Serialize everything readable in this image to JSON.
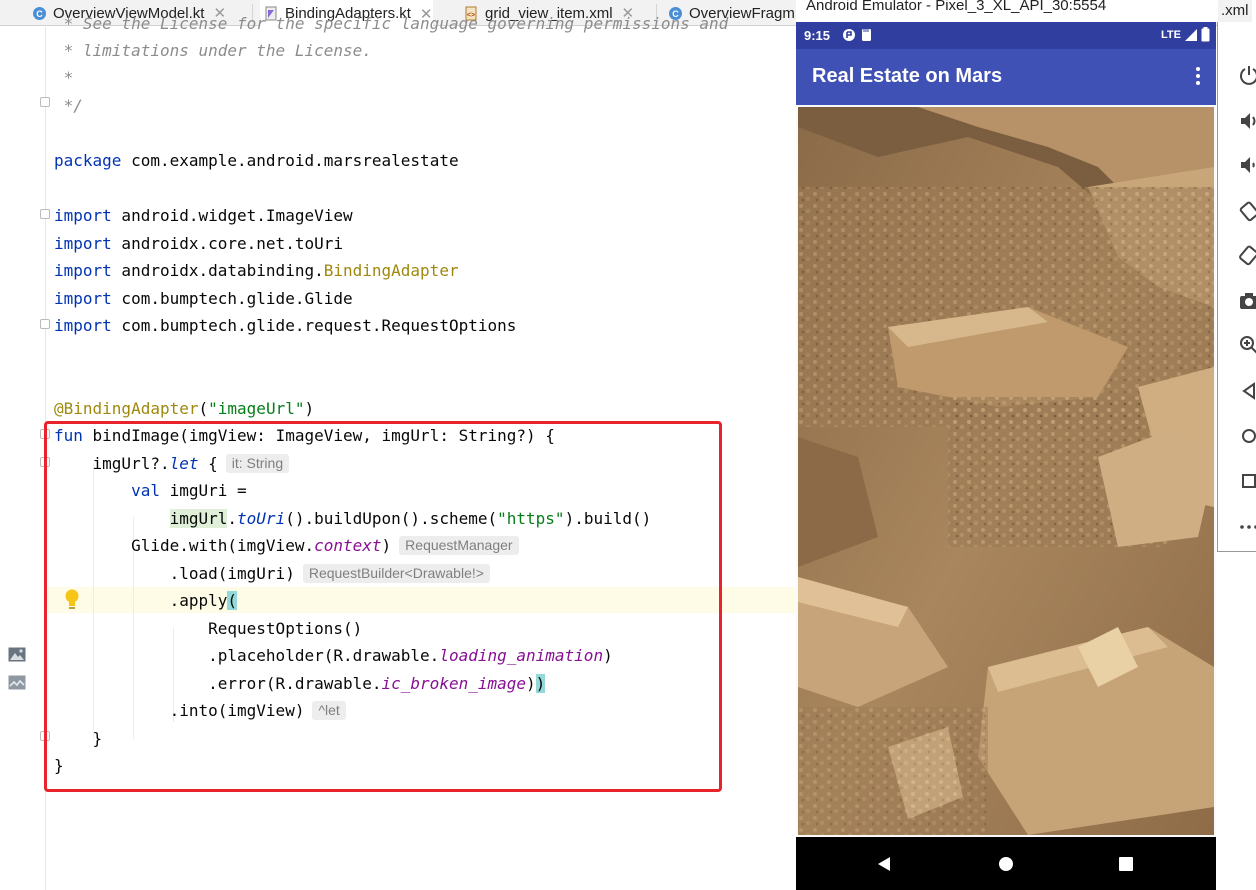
{
  "tabs": [
    {
      "label": "OverviewViewModel.kt",
      "icon": "kotlin-class-icon",
      "active": false
    },
    {
      "label": "BindingAdapters.kt",
      "icon": "kotlin-file-icon",
      "active": true
    },
    {
      "label": "grid_view_item.xml",
      "icon": "xml-file-icon",
      "active": false
    },
    {
      "label": "OverviewFragm",
      "icon": "kotlin-class-icon",
      "active": false
    }
  ],
  "overflow_tab": ".xml",
  "code": {
    "comment_lines": [
      " * See the License for the specific language governing permissions and",
      " * limitations under the License.",
      " *",
      " */"
    ],
    "package_kw": "package",
    "package_name": " com.example.android.marsrealestate",
    "imports": [
      {
        "kw": "import",
        "path": " android.widget.ImageView",
        "annotated": false
      },
      {
        "kw": "import",
        "path": " androidx.core.net.toUri",
        "annotated": false
      },
      {
        "kw": "import",
        "path": " androidx.databinding.",
        "annotated_part": "BindingAdapter",
        "annotated": true
      },
      {
        "kw": "import",
        "path": " com.bumptech.glide.Glide",
        "annotated": false
      },
      {
        "kw": "import",
        "path": " com.bumptech.glide.request.RequestOptions",
        "annotated": false
      }
    ],
    "annotation": "@BindingAdapter",
    "annotation_arg": "\"imageUrl\"",
    "fun_kw": "fun",
    "fun_sig": " bindImage(imgView: ImageView, imgUrl: String?) {",
    "let_prefix": "    imgUrl?.",
    "let_kw": "let",
    "let_suffix": " {",
    "hint_it": "it: String",
    "val_kw": "val",
    "val_decl": " imgUri =",
    "uri_var": "imgUrl",
    "uri_call_dot": ".",
    "uri_fn": "toUri",
    "uri_chain_a": "().buildUpon().scheme(",
    "uri_scheme": "\"https\"",
    "uri_chain_b": ").build()",
    "glide_a": "Glide.with(imgView.",
    "glide_prop": "context",
    "glide_b": ")",
    "hint_glide": "RequestManager",
    "load_call": ".load(imgUri)",
    "hint_load": "RequestBuilder<Drawable!>",
    "apply_call": ".apply",
    "apply_paren": "(",
    "req_options": "RequestOptions()",
    "placeholder_a": ".placeholder(R.drawable.",
    "placeholder_res": "loading_animation",
    "placeholder_b": ")",
    "error_a": ".error(R.drawable.",
    "error_res": "ic_broken_image",
    "error_b": ")",
    "error_c": ")",
    "into_call": ".into(imgView)",
    "hint_into": "^let",
    "close_inner": "    }",
    "close_outer": "}"
  },
  "emulator": {
    "window_title": "Android Emulator - Pixel_3_XL_API_30:5554",
    "time": "9:15",
    "network": "LTE",
    "app_title": "Real Estate on Mars",
    "image_icon": "mars-surface-photo"
  },
  "colors": {
    "app_bar": "#3f51b5",
    "status_bar": "#303f9f",
    "highlight_box": "#e8232b"
  }
}
